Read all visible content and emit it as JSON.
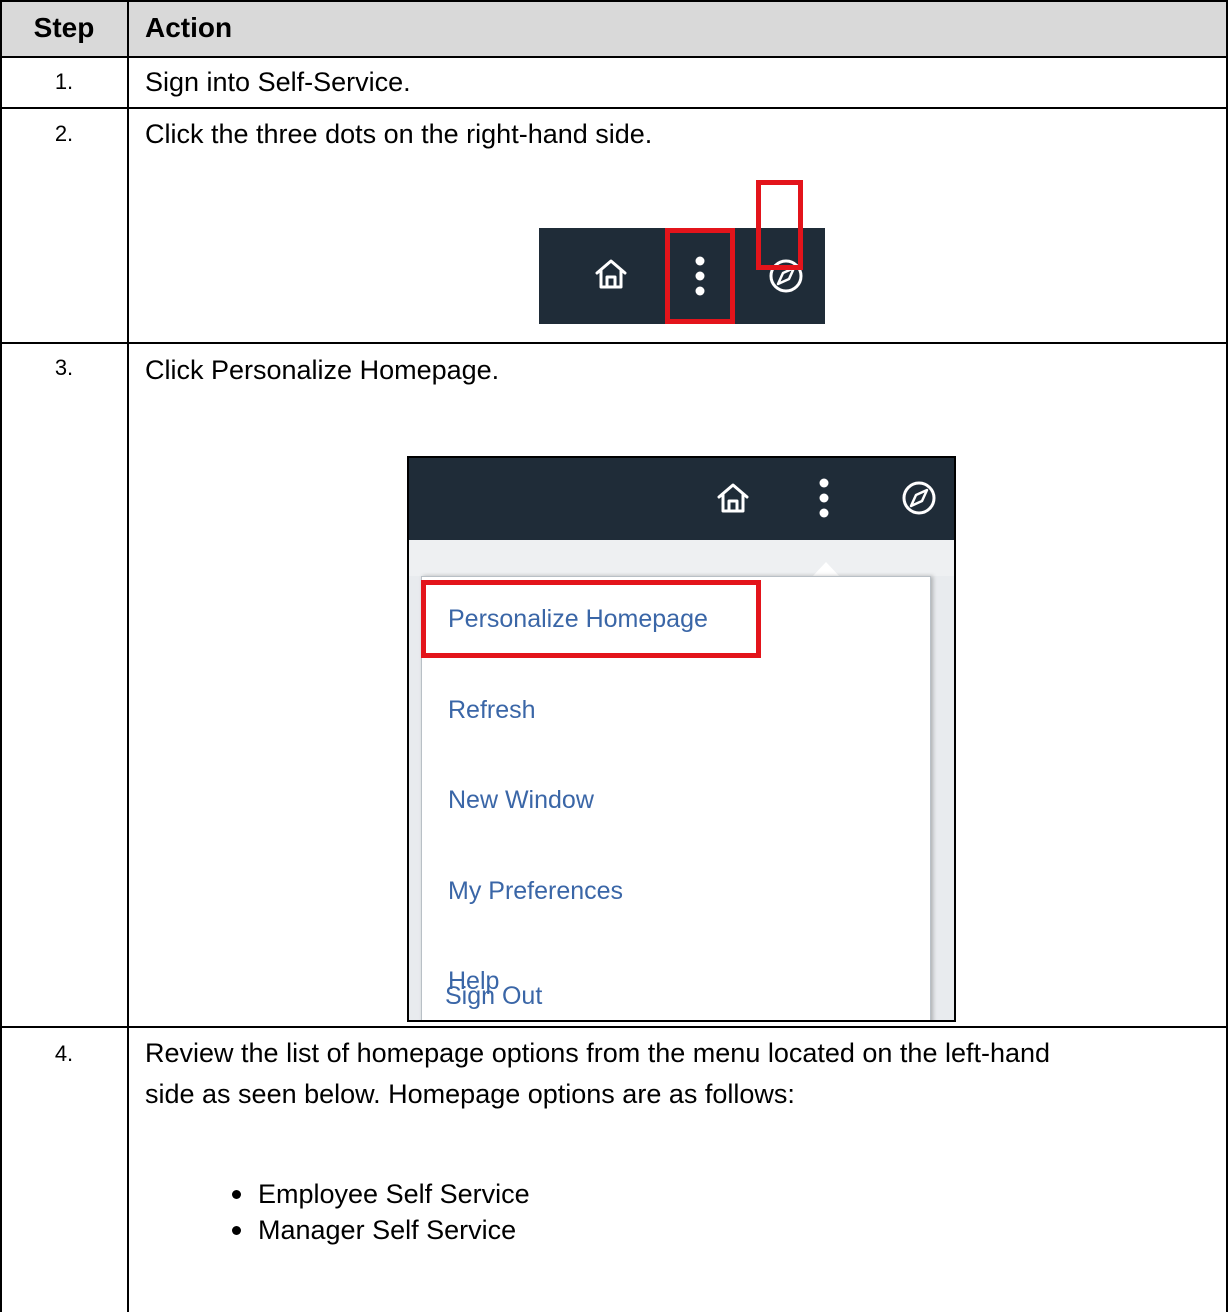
{
  "table": {
    "header": {
      "step": "Step",
      "action": "Action"
    },
    "rows": [
      {
        "step": "1.",
        "action": "Sign into Self-Service."
      },
      {
        "step": "2.",
        "action": "Click the three dots on the right-hand side."
      },
      {
        "step": "3.",
        "action": "Click Personalize Homepage."
      },
      {
        "step": "4.",
        "action_line1": "Review the list of homepage options from the menu located on the left-hand",
        "action_line2": "side as seen below. Homepage options are as follows:",
        "bullets": [
          "Employee Self Service",
          "Manager Self Service"
        ]
      }
    ]
  },
  "toolbar_icons": [
    "home-icon",
    "more-vertical-icon",
    "compass-icon"
  ],
  "menu": {
    "items": [
      "Personalize Homepage",
      "Refresh",
      "New Window",
      "My Preferences",
      "Help",
      "Sign Out"
    ],
    "highlighted": "Personalize Homepage"
  },
  "colors": {
    "highlight_red": "#e3141b",
    "toolbar_bg": "#1f2c38",
    "menu_link": "#3a66a7",
    "header_bg": "#d9d9d9"
  }
}
